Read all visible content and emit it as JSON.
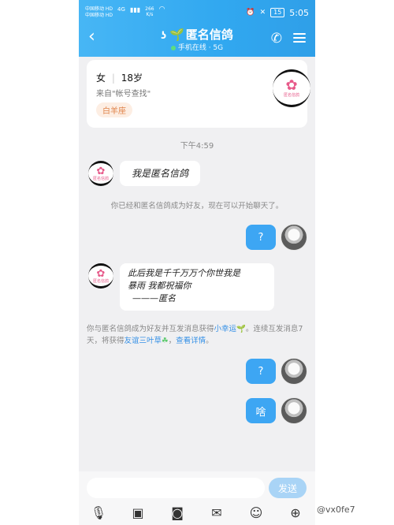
{
  "status_bar": {
    "carrier1": "中国移动 HD",
    "carrier2": "中国移动 HD",
    "signal": "4G",
    "speed_value": "266",
    "speed_unit": "K/s",
    "battery": "15",
    "time": "5:05"
  },
  "header": {
    "title": "匿名信鸽",
    "subtitle": "手机在线 · 5G",
    "back_glyph": "‹",
    "ear_glyph": "ʖ",
    "leaf_glyph": "🌱",
    "phone_glyph": "✆"
  },
  "profile_card": {
    "gender": "女",
    "age": "18岁",
    "source": "来自\"帐号查找\"",
    "tag": "白羊座",
    "avatar_label": "匿名信鸽"
  },
  "chat": {
    "timestamp": "下午4:59",
    "msg1": "我是匿名信鸽",
    "system1": "你已经和匿名信鸽成为好友，现在可以开始聊天了。",
    "reply1": "?",
    "msg2_line1": "此后我是千千万万个你世我是",
    "msg2_line2": "暴雨 我都祝福你",
    "msg2_line3": "———匿名",
    "system2_prefix": "你与匿名信鸽成为好友并互发消息获得",
    "system2_link1": "小幸运",
    "system2_mid": "。连续互发消息7天，将获得",
    "system2_link2": "友谊三叶草",
    "system2_sep": "，",
    "system2_link3": "查看详情",
    "system2_end": "。",
    "reply2": "?",
    "reply3": "啥"
  },
  "input_bar": {
    "send_label": "发送",
    "tools": [
      "mic-icon",
      "image-icon",
      "camera-icon",
      "red-packet-icon",
      "emoji-icon",
      "plus-icon"
    ]
  },
  "watermark": "@vx0fe7"
}
